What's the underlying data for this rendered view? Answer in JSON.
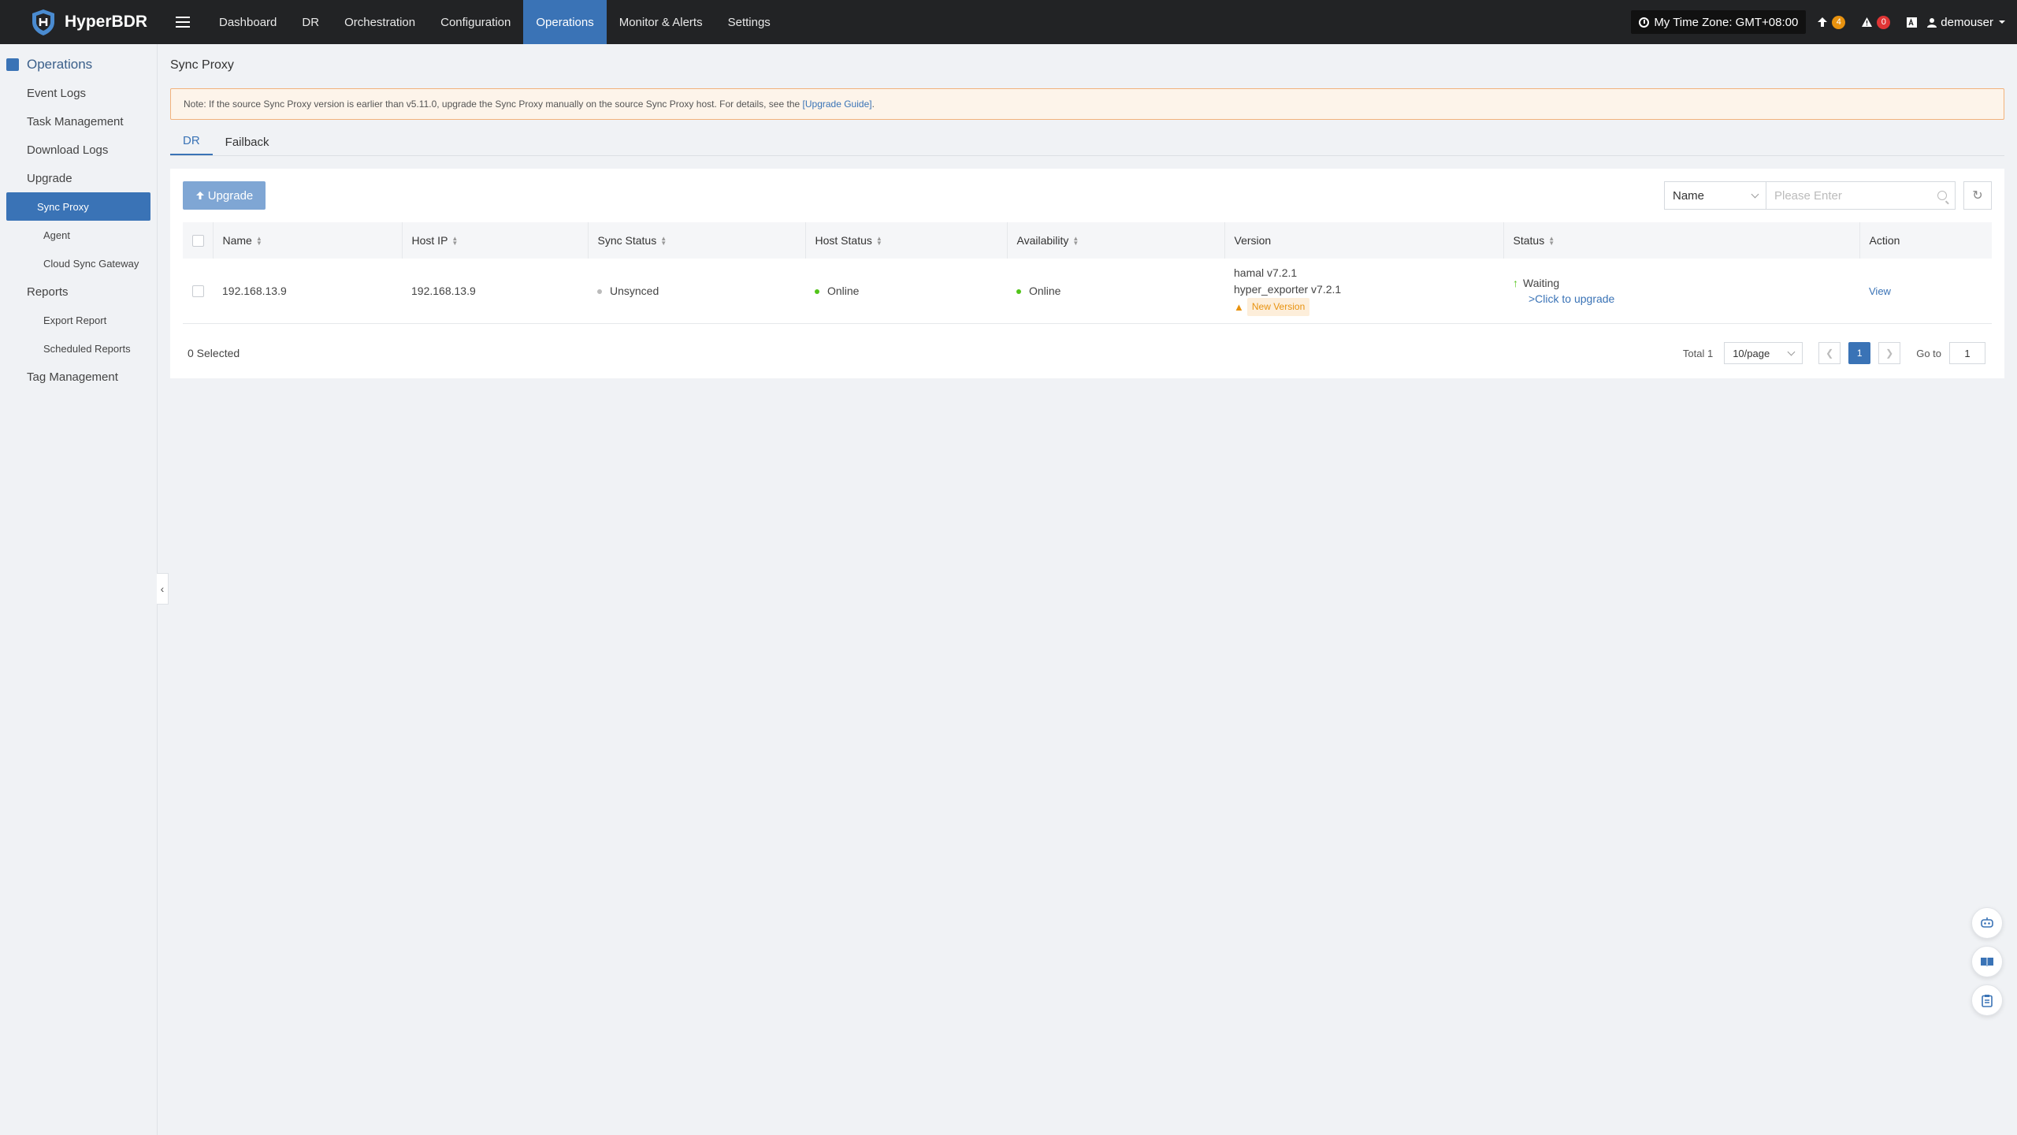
{
  "app": {
    "name": "HyperBDR"
  },
  "nav": {
    "items": [
      {
        "label": "Dashboard",
        "active": false
      },
      {
        "label": "DR",
        "active": false
      },
      {
        "label": "Orchestration",
        "active": false
      },
      {
        "label": "Configuration",
        "active": false
      },
      {
        "label": "Operations",
        "active": true
      },
      {
        "label": "Monitor & Alerts",
        "active": false
      },
      {
        "label": "Settings",
        "active": false
      }
    ]
  },
  "topright": {
    "timezone": "My Time Zone: GMT+08:00",
    "upgrade_count": "4",
    "alert_count": "0",
    "user": "demouser"
  },
  "sidebar": {
    "title": "Operations",
    "items": [
      {
        "label": "Event Logs",
        "level": 1
      },
      {
        "label": "Task Management",
        "level": 1
      },
      {
        "label": "Download Logs",
        "level": 1
      },
      {
        "label": "Upgrade",
        "level": 1
      },
      {
        "label": "Sync Proxy",
        "level": 2,
        "active": true
      },
      {
        "label": "Agent",
        "level": 2
      },
      {
        "label": "Cloud Sync Gateway",
        "level": 2
      },
      {
        "label": "Reports",
        "level": 1
      },
      {
        "label": "Export Report",
        "level": 2
      },
      {
        "label": "Scheduled Reports",
        "level": 2
      },
      {
        "label": "Tag Management",
        "level": 1
      }
    ]
  },
  "page": {
    "title": "Sync Proxy",
    "note_text": "Note: If the source Sync Proxy version is earlier than v5.11.0, upgrade the Sync Proxy manually on the source Sync Proxy host. For details, see the ",
    "note_link": "[Upgrade Guide]",
    "note_end": ".",
    "tabs": [
      "DR",
      "Failback"
    ],
    "active_tab": "DR"
  },
  "toolbar": {
    "upgrade_label": "Upgrade",
    "filter_select": "Name",
    "search_placeholder": "Please Enter"
  },
  "table": {
    "columns": [
      "Name",
      "Host IP",
      "Sync Status",
      "Host Status",
      "Availability",
      "Version",
      "Status",
      "Action"
    ],
    "rows": [
      {
        "name": "192.168.13.9",
        "host_ip": "192.168.13.9",
        "sync_status": "Unsynced",
        "host_status": "Online",
        "availability": "Online",
        "version_1": "hamal v7.2.1",
        "version_2": "hyper_exporter v7.2.1",
        "version_tag": "New Version",
        "status": "Waiting",
        "status_link": ">Click to upgrade",
        "action": "View"
      }
    ]
  },
  "footer": {
    "selected": "0 Selected",
    "total": "Total 1",
    "page_size": "10/page",
    "current_page": "1",
    "goto_label": "Go to",
    "goto_value": "1"
  },
  "colors": {
    "accent": "#3a73b6",
    "topbar": "#222325",
    "online": "#52c41a",
    "warning": "#e8920f"
  }
}
